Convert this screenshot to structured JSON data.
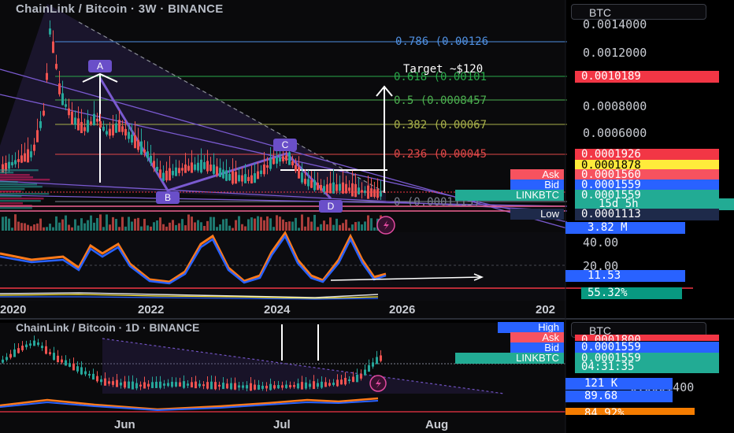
{
  "top_chart": {
    "title": "ChainLink / Bitcoin · 3W · BINANCE",
    "currency_button": "BTC",
    "price_ticks": [
      "0.0014000",
      "0.0012000",
      "0.0008000",
      "0.0006000"
    ],
    "osc_ticks": [
      "40.00",
      "20.00"
    ],
    "year_labels": [
      "2020",
      "2022",
      "2024",
      "2026",
      "202"
    ],
    "fib_levels": [
      {
        "label": "0.786 (0.00126",
        "color": "#4f8fe0"
      },
      {
        "label": "0.618 (0.00101",
        "color": "#2aa84a"
      },
      {
        "label": "0.5 (0.0008457",
        "color": "#4caf50"
      },
      {
        "label": "0.382 (0.00067",
        "color": "#a8b04a"
      },
      {
        "label": "0.236 (0.00045",
        "color": "#e04848"
      },
      {
        "label": "0 (0.0001113)",
        "color": "#7d8290"
      }
    ],
    "target_label": "Target ~$120",
    "wave_labels": [
      "A",
      "B",
      "C",
      "D"
    ],
    "price_tags": [
      {
        "label": "",
        "value": "0.0010189",
        "bg": "#f23645",
        "fg": "#ffffff"
      },
      {
        "label": "",
        "value": "0.0001926",
        "bg": "#f23645",
        "fg": "#ffffff"
      },
      {
        "label": "",
        "value": "0.0001878",
        "bg": "#ffeb3b",
        "fg": "#000000"
      },
      {
        "label": "Ask",
        "value": "0.0001560",
        "bg": "#f7525f",
        "fg": "#ffffff"
      },
      {
        "label": "Bid",
        "value": "0.0001559",
        "bg": "#2962ff",
        "fg": "#ffffff"
      },
      {
        "label": "LINKBTC",
        "value": "0.0001559",
        "bg": "#22ab94",
        "fg": "#ffffff"
      },
      {
        "label": "",
        "value": "15d 5h",
        "bg": "#22ab94",
        "fg": "#ffffff"
      },
      {
        "label": "Low",
        "value": "0.0001113",
        "bg": "#1e2a4a",
        "fg": "#ffffff"
      },
      {
        "label": "",
        "value": "3.82 M",
        "bg": "#2962ff",
        "fg": "#ffffff"
      },
      {
        "label": "",
        "value": "11.53",
        "bg": "#2962ff",
        "fg": "#ffffff"
      },
      {
        "label": "",
        "value": "55.32%",
        "bg": "#089981",
        "fg": "#ffffff"
      }
    ]
  },
  "bottom_chart": {
    "title": "ChainLink / Bitcoin · 1D · BINANCE",
    "currency_button": "BTC",
    "month_labels": [
      "Jun",
      "Jul",
      "Aug"
    ],
    "tick_partial": "0.0001400",
    "left_tags": [
      {
        "label": "High",
        "bg": "#2962ff"
      },
      {
        "label": "Ask",
        "bg": "#f7525f"
      },
      {
        "label": "Bid",
        "bg": "#2962ff"
      },
      {
        "label": "LINKBTC",
        "bg": "#22ab94"
      }
    ],
    "price_tags": [
      {
        "value": "0.0001800",
        "bg": "#f23645",
        "fg": "#ffffff"
      },
      {
        "value": "0.0001559",
        "bg": "#2962ff",
        "fg": "#ffffff"
      },
      {
        "value": "0.0001559",
        "bg": "#22ab94",
        "fg": "#ffffff"
      },
      {
        "value": "04:31:35",
        "bg": "#22ab94",
        "fg": "#ffffff"
      },
      {
        "value": "121 K",
        "bg": "#2962ff",
        "fg": "#ffffff"
      },
      {
        "value": "89.68",
        "bg": "#2962ff",
        "fg": "#ffffff"
      },
      {
        "value": "84.92%",
        "bg": "#f57c00",
        "fg": "#ffffff"
      }
    ]
  }
}
